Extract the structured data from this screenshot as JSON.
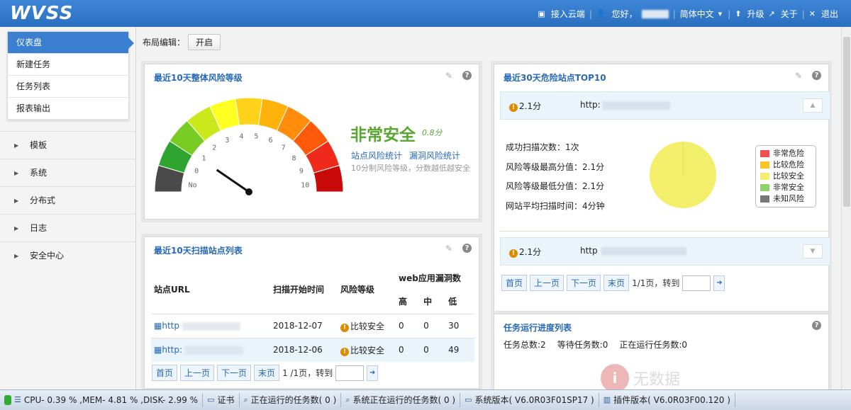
{
  "header": {
    "logo": "WVSS",
    "cloud": "接入云端",
    "greeting": "您好，",
    "language": "简体中文",
    "upgrade": "升级",
    "about": "关于",
    "logout": "退出"
  },
  "sidebar": {
    "submenu": [
      {
        "label": "仪表盘",
        "active": true
      },
      {
        "label": "新建任务"
      },
      {
        "label": "任务列表"
      },
      {
        "label": "报表输出"
      }
    ],
    "groups": [
      "模板",
      "系统",
      "分布式",
      "日志",
      "安全中心"
    ]
  },
  "layout_edit": {
    "label": "布局编辑：",
    "button": "开启"
  },
  "risk_panel": {
    "title": "最近10天整体风险等级",
    "level": "非常安全",
    "score": "0.8分",
    "link1": "站点风险统计",
    "link2": "漏洞风险统计",
    "desc": "10分制风险等级，分数越低越安全",
    "gauge_value": 0.8,
    "gauge_labels": [
      "No",
      "0",
      "1",
      "2",
      "3",
      "4",
      "5",
      "6",
      "7",
      "8",
      "9",
      "10"
    ],
    "gauge_colors": [
      "#4a4a4a",
      "#2fa52f",
      "#78cc22",
      "#c9e91a",
      "#ffff22",
      "#ffd21a",
      "#ffb20a",
      "#ff8c0a",
      "#ff5a0a",
      "#f02a1a",
      "#c80a0a"
    ]
  },
  "scan_panel": {
    "title": "最近10天扫描站点列表",
    "headers": {
      "url": "站点URL",
      "time": "扫描开始时间",
      "risk": "风险等级",
      "vuln": "web应用漏洞数",
      "high": "高",
      "mid": "中",
      "low": "低"
    },
    "rows": [
      {
        "url": "http",
        "time": "2018-12-07",
        "risk": "比较安全",
        "high": "0",
        "mid": "0",
        "low": "30"
      },
      {
        "url": "http:",
        "time": "2018-12-06",
        "risk": "比较安全",
        "high": "0",
        "mid": "0",
        "low": "49"
      }
    ],
    "pager": {
      "first": "首页",
      "prev": "上一页",
      "next": "下一页",
      "last": "末页",
      "info": "1 /1页，转到"
    }
  },
  "top10_panel": {
    "title": "最近30天危险站点TOP10",
    "items": [
      {
        "score": "2.1分",
        "url": "http:"
      },
      {
        "score": "2.1分",
        "url": "http"
      }
    ],
    "stats": [
      "成功扫描次数：1次",
      "风险等级最高分值：2.1分",
      "风险等级最低分值：2.1分",
      "网站平均扫描时间：4分钟"
    ],
    "legend": [
      {
        "label": "非常危险",
        "color": "#f05050"
      },
      {
        "label": "比较危险",
        "color": "#f7c72a"
      },
      {
        "label": "比较安全",
        "color": "#f4ef6a"
      },
      {
        "label": "非常安全",
        "color": "#8fd16a"
      },
      {
        "label": "未知风险",
        "color": "#777777"
      }
    ],
    "pie_color": "#f4ef6a",
    "pager": {
      "first": "首页",
      "prev": "上一页",
      "next": "下一页",
      "last": "末页",
      "info": "1/1页，转到"
    }
  },
  "progress_panel": {
    "title": "任务运行进度列表",
    "total": "任务总数:2",
    "waiting": "等待任务数:0",
    "running": "正在运行任务数:0",
    "empty": "无数据"
  },
  "statusbar": {
    "cpu": "CPU- 0.39 % ,MEM- 4.81 % ,DISK- 2.99 %",
    "cert": "证书",
    "running": "正在运行的任务数( 0 )",
    "sys_running": "系统正在运行的任务数( 0 )",
    "sys_version": "系统版本( V6.0R03F01SP17 )",
    "plugin_version": "插件版本( V6.0R03F00.120 )"
  }
}
